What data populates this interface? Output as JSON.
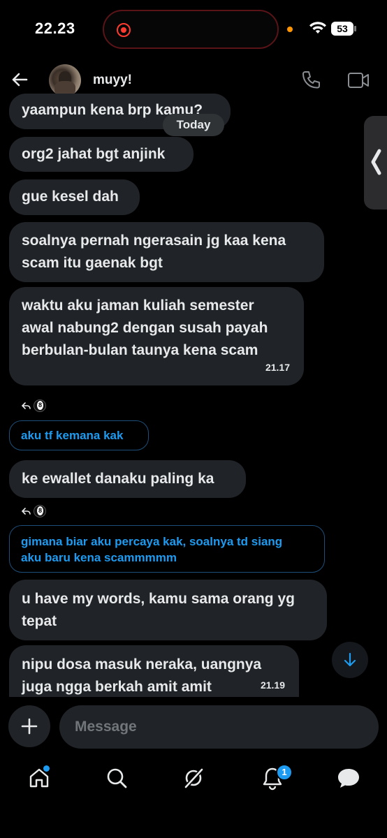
{
  "status_bar": {
    "time": "22.23",
    "battery": "53"
  },
  "header": {
    "contact_name": "muyy!"
  },
  "date_divider": "Today",
  "messages": [
    {
      "text": "yaampun kena brp kamu?"
    },
    {
      "text": "org2 jahat bgt anjink"
    },
    {
      "text": "gue kesel dah"
    },
    {
      "line1": "soalnya pernah ngerasain jg kaa kena",
      "line2": "scam itu gaenak bgt"
    },
    {
      "line1": "waktu aku jaman kuliah semester",
      "line2": "awal nabung2 dengan susah payah",
      "line3": "berbulan-bulan taunya kena scam",
      "time": "21.17"
    },
    {
      "text": "ke ewallet danaku paling ka"
    },
    {
      "line1": "u have my words, kamu sama orang yg",
      "line2": "tepat"
    },
    {
      "line1": "nipu dosa masuk neraka, uangnya",
      "line2": "juga ngga berkah amit amit",
      "time": "21.19"
    }
  ],
  "replies": [
    {
      "text": "aku tf kemana kak"
    },
    {
      "line1": "gimana biar aku percaya kak, soalnya td siang",
      "line2": "aku baru kena scammmmm"
    }
  ],
  "composer": {
    "placeholder": "Message"
  },
  "tab_bar": {
    "notification_count": "1"
  },
  "colors": {
    "accent": "#1d9bf0",
    "bubble": "#202327",
    "background": "#000000"
  }
}
